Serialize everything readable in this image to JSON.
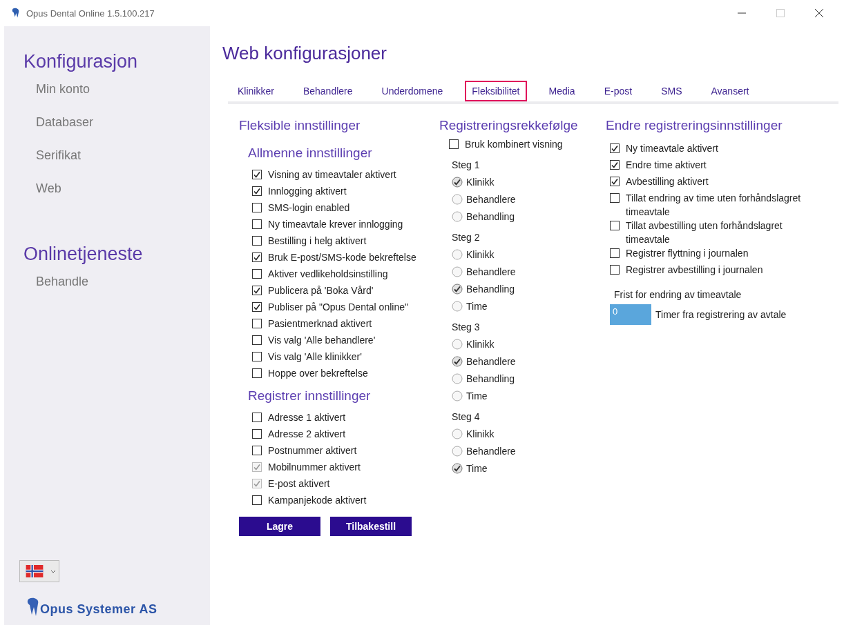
{
  "window": {
    "title": "Opus Dental Online 1.5.100.217"
  },
  "sidebar": {
    "sections": [
      {
        "heading": "Konfigurasjon",
        "items": [
          "Min konto",
          "Databaser",
          "Serifikat",
          "Web"
        ]
      },
      {
        "heading": "Onlinetjeneste",
        "items": [
          "Behandle"
        ]
      }
    ],
    "logo": "Opus Systemer AS"
  },
  "page": {
    "title": "Web konfigurasjoner",
    "tabs": [
      {
        "label": "Klinikker",
        "selected": false
      },
      {
        "label": "Behandlere",
        "selected": false
      },
      {
        "label": "Underdomene",
        "selected": false
      },
      {
        "label": "Fleksibilitet",
        "selected": true
      },
      {
        "label": "Media",
        "selected": false
      },
      {
        "label": "E-post",
        "selected": false
      },
      {
        "label": "SMS",
        "selected": false
      },
      {
        "label": "Avansert",
        "selected": false
      }
    ],
    "flexible": {
      "heading": "Fleksible innstillinger",
      "groups": [
        {
          "heading": "Allmenne innstillinger",
          "items": [
            {
              "label": "Visning av timeavtaler aktivert",
              "checked": true,
              "disabled": false
            },
            {
              "label": "Innlogging aktivert",
              "checked": true,
              "disabled": false
            },
            {
              "label": "SMS-login enabled",
              "checked": false,
              "disabled": false
            },
            {
              "label": "Ny timeavtale krever innlogging",
              "checked": false,
              "disabled": false
            },
            {
              "label": "Bestilling i helg aktivert",
              "checked": false,
              "disabled": false
            },
            {
              "label": "Bruk E-post/SMS-kode bekreftelse",
              "checked": true,
              "disabled": false
            },
            {
              "label": "Aktiver vedlikeholdsinstilling",
              "checked": false,
              "disabled": false
            },
            {
              "label": "Publicera på 'Boka Vård'",
              "checked": true,
              "disabled": false
            },
            {
              "label": "Publiser på \"Opus Dental online\"",
              "checked": true,
              "disabled": false
            },
            {
              "label": "Pasientmerknad aktivert",
              "checked": false,
              "disabled": false
            },
            {
              "label": "Vis valg 'Alle behandlere'",
              "checked": false,
              "disabled": false
            },
            {
              "label": "Vis valg 'Alle klinikker'",
              "checked": false,
              "disabled": false
            },
            {
              "label": "Hoppe over bekreftelse",
              "checked": false,
              "disabled": false
            }
          ]
        },
        {
          "heading": "Registrer innstillinger",
          "items": [
            {
              "label": "Adresse 1 aktivert",
              "checked": false,
              "disabled": false
            },
            {
              "label": "Adresse 2 aktivert",
              "checked": false,
              "disabled": false
            },
            {
              "label": "Postnummer aktivert",
              "checked": false,
              "disabled": false
            },
            {
              "label": "Mobilnummer aktivert",
              "checked": true,
              "disabled": true
            },
            {
              "label": "E-post aktivert",
              "checked": true,
              "disabled": true
            },
            {
              "label": "Kampanjekode aktivert",
              "checked": false,
              "disabled": false
            }
          ]
        }
      ],
      "buttons": [
        "Lagre",
        "Tilbakestill"
      ]
    },
    "order": {
      "heading": "Registreringsrekkefølge",
      "combined": {
        "label": "Bruk kombinert visning",
        "checked": false
      },
      "steps": [
        {
          "label": "Steg 1",
          "options": [
            {
              "label": "Klinikk",
              "selected": true
            },
            {
              "label": "Behandlere",
              "selected": false
            },
            {
              "label": "Behandling",
              "selected": false
            }
          ]
        },
        {
          "label": "Steg 2",
          "options": [
            {
              "label": "Klinikk",
              "selected": false
            },
            {
              "label": "Behandlere",
              "selected": false
            },
            {
              "label": "Behandling",
              "selected": true
            },
            {
              "label": "Time",
              "selected": false
            }
          ]
        },
        {
          "label": "Steg 3",
          "options": [
            {
              "label": "Klinikk",
              "selected": false
            },
            {
              "label": "Behandlere",
              "selected": true
            },
            {
              "label": "Behandling",
              "selected": false
            },
            {
              "label": "Time",
              "selected": false
            }
          ]
        },
        {
          "label": "Steg 4",
          "options": [
            {
              "label": "Klinikk",
              "selected": false
            },
            {
              "label": "Behandlere",
              "selected": false
            },
            {
              "label": "Time",
              "selected": true
            }
          ]
        }
      ]
    },
    "change": {
      "heading": "Endre registreringsinnstillinger",
      "items": [
        {
          "label": "Ny timeavtale aktivert",
          "checked": true
        },
        {
          "label": "Endre time aktivert",
          "checked": true
        },
        {
          "label": "Avbestilling aktivert",
          "checked": true
        },
        {
          "label": "Tillat endring av time uten forhåndslagret timeavtale",
          "checked": false
        },
        {
          "label": "Tillat avbestilling uten forhåndslagret timeavtale",
          "checked": false
        },
        {
          "label": "Registrer flyttning i journalen",
          "checked": false
        },
        {
          "label": "Registrer avbestilling i journalen",
          "checked": false
        }
      ],
      "deadline": {
        "label": "Frist for endring av timeavtale",
        "value": "0",
        "unit": "Timer fra registrering av avtale"
      }
    }
  }
}
